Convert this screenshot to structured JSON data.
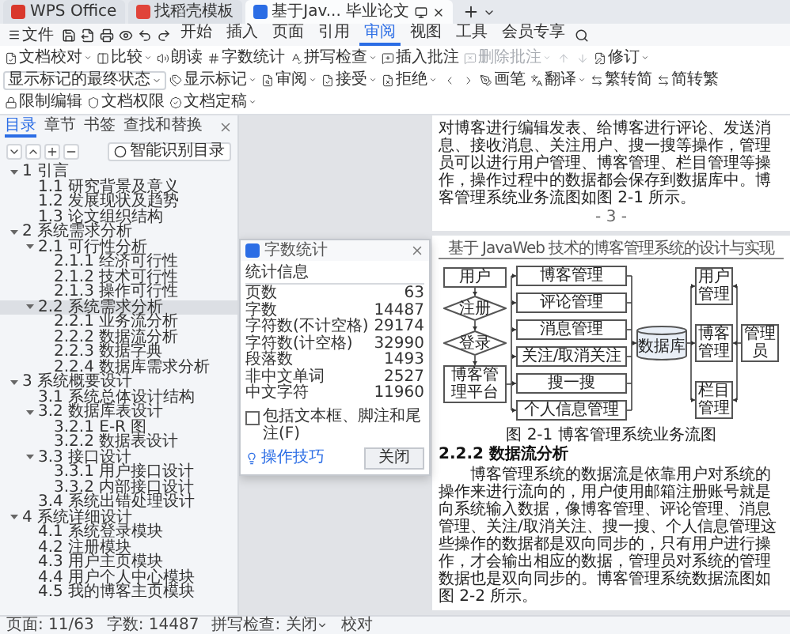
{
  "tabs": [
    {
      "label": "WPS Office",
      "kind": "home",
      "selected": false
    },
    {
      "label": "找稻壳模板",
      "kind": "template",
      "selected": false
    },
    {
      "label": "基于Jav... 毕业论文",
      "kind": "document",
      "selected": true
    }
  ],
  "menu": {
    "file": "文件",
    "tabs": [
      {
        "label": "开始",
        "selected": false
      },
      {
        "label": "插入",
        "selected": false
      },
      {
        "label": "页面",
        "selected": false
      },
      {
        "label": "引用",
        "selected": false
      },
      {
        "label": "审阅",
        "selected": true
      },
      {
        "label": "视图",
        "selected": false
      },
      {
        "label": "工具",
        "selected": false
      },
      {
        "label": "会员专享",
        "selected": false
      }
    ]
  },
  "ribbon": [
    {
      "kind": "button",
      "label": "文档校对",
      "caret": true,
      "disabled": false
    },
    {
      "kind": "button",
      "label": "比较",
      "caret": true,
      "disabled": false
    },
    {
      "kind": "button",
      "label": "朗读",
      "caret": false,
      "disabled": false
    },
    {
      "kind": "button",
      "label": "字数统计",
      "caret": false,
      "disabled": false
    },
    {
      "kind": "button",
      "label": "拼写检查",
      "caret": true,
      "disabled": false
    },
    {
      "kind": "button",
      "label": "插入批注",
      "caret": false,
      "disabled": false
    },
    {
      "kind": "button",
      "label": "删除批注",
      "caret": true,
      "disabled": true
    },
    {
      "kind": "icon",
      "disabled": true
    },
    {
      "kind": "icon",
      "disabled": true
    },
    {
      "kind": "button",
      "label": "修订",
      "caret": true,
      "disabled": false
    },
    {
      "kind": "dropdown",
      "value": "显示标记的最终状态"
    },
    {
      "kind": "button",
      "label": "显示标记",
      "caret": true,
      "disabled": false
    },
    {
      "kind": "button",
      "label": "审阅",
      "caret": true,
      "disabled": false
    },
    {
      "kind": "button",
      "label": "接受",
      "caret": true,
      "disabled": false
    },
    {
      "kind": "button",
      "label": "拒绝",
      "caret": true,
      "disabled": false
    },
    {
      "kind": "icon",
      "disabled": false
    },
    {
      "kind": "icon",
      "disabled": false
    },
    {
      "kind": "button",
      "label": "画笔",
      "caret": false,
      "disabled": false
    },
    {
      "kind": "button",
      "label": "翻译",
      "caret": true,
      "disabled": false
    },
    {
      "kind": "button",
      "label": "繁转简",
      "caret": false,
      "disabled": false
    },
    {
      "kind": "button",
      "label": "简转繁",
      "caret": false,
      "disabled": false
    },
    {
      "kind": "button",
      "label": "限制编辑",
      "caret": false,
      "disabled": false
    },
    {
      "kind": "button",
      "label": "文档权限",
      "caret": false,
      "disabled": false
    },
    {
      "kind": "button",
      "label": "文档定稿",
      "caret": true,
      "disabled": false
    }
  ],
  "sidebar": {
    "tabs": [
      {
        "label": "目录",
        "selected": true
      },
      {
        "label": "章节",
        "selected": false
      },
      {
        "label": "书签",
        "selected": false
      },
      {
        "label": "查找和替换",
        "selected": false
      }
    ],
    "smart_button": "智能识别目录",
    "outline": [
      {
        "label": "1 引言",
        "expanded": true,
        "selected": false,
        "children": [
          {
            "label": "1.1 研究背景及意义",
            "selected": false
          },
          {
            "label": "1.2 发展现状及趋势",
            "selected": false
          },
          {
            "label": "1.3 论文组织结构",
            "selected": false
          }
        ]
      },
      {
        "label": "2 系统需求分析",
        "expanded": true,
        "selected": false,
        "children": [
          {
            "label": "2.1 可行性分析",
            "expanded": true,
            "selected": false,
            "children": [
              {
                "label": "2.1.1 经济可行性",
                "selected": false
              },
              {
                "label": "2.1.2 技术可行性",
                "selected": false
              },
              {
                "label": "2.1.3 操作可行性",
                "selected": false
              }
            ]
          },
          {
            "label": "2.2 系统需求分析",
            "expanded": true,
            "selected": true,
            "children": [
              {
                "label": "2.2.1 业务流分析",
                "selected": false
              },
              {
                "label": "2.2.2 数据流分析",
                "selected": false
              },
              {
                "label": "2.2.3 数据字典",
                "selected": false
              },
              {
                "label": "2.2.4 数据库需求分析",
                "selected": false
              }
            ]
          }
        ]
      },
      {
        "label": "3 系统概要设计",
        "expanded": true,
        "selected": false,
        "children": [
          {
            "label": "3.1 系统总体设计结构",
            "selected": false
          },
          {
            "label": "3.2 数据库表设计",
            "expanded": true,
            "selected": false,
            "children": [
              {
                "label": "3.2.1 E-R 图",
                "selected": false
              },
              {
                "label": "3.2.2 数据表设计",
                "selected": false
              }
            ]
          },
          {
            "label": "3.3 接口设计",
            "expanded": true,
            "selected": false,
            "children": [
              {
                "label": "3.3.1 用户接口设计",
                "selected": false
              },
              {
                "label": "3.3.2 内部接口设计",
                "selected": false
              }
            ]
          },
          {
            "label": "3.4 系统出错处理设计",
            "selected": false
          }
        ]
      },
      {
        "label": "4 系统详细设计",
        "expanded": true,
        "selected": false,
        "children": [
          {
            "label": "4.1 系统登录模块",
            "selected": false
          },
          {
            "label": "4.2 注册模块",
            "selected": false
          },
          {
            "label": "4.3 用户主页模块",
            "selected": false
          },
          {
            "label": "4.4 用户个人中心模块",
            "selected": false
          },
          {
            "label": "4.5 我的博客主页模块",
            "selected": false
          }
        ]
      }
    ]
  },
  "dialog": {
    "title": "字数统计",
    "section": "统计信息",
    "stats": [
      {
        "label": "页数",
        "value": "63"
      },
      {
        "label": "字数",
        "value": "14487"
      },
      {
        "label": "字符数(不计空格)",
        "value": "29174"
      },
      {
        "label": "字符数(计空格)",
        "value": "32990"
      },
      {
        "label": "段落数",
        "value": "1493"
      },
      {
        "label": "非中文单词",
        "value": "2527"
      },
      {
        "label": "中文字符",
        "value": "11960"
      }
    ],
    "checkbox": {
      "label": "包括文本框、脚注和尾注(F)",
      "checked": false
    },
    "tips_link": "操作技巧",
    "close_button": "关闭"
  },
  "document": {
    "page1": {
      "paragraph": "对博客进行编辑发表、给博客进行评论、发送消息、接收消息、关注用户、搜一搜等操作，管理员可以进行用户管理、博客管理、栏目管理等操作，操作过程中的数据都会保存到数据库中。博客管理系统业务流图如图 2-1 所示。",
      "page_number": "- 3 -"
    },
    "page2": {
      "header": "基于 JavaWeb 技术的博客管理系统的设计与实现",
      "diagram": [
        {
          "kind": "process",
          "label": "用户"
        },
        {
          "kind": "decision",
          "label": "注册"
        },
        {
          "kind": "decision",
          "label": "登录"
        },
        {
          "kind": "process",
          "label": "博客管理平台"
        },
        {
          "kind": "process",
          "label": "博客管理"
        },
        {
          "kind": "process",
          "label": "评论管理"
        },
        {
          "kind": "process",
          "label": "消息管理"
        },
        {
          "kind": "process",
          "label": "关注/取消关注"
        },
        {
          "kind": "process",
          "label": "搜一搜"
        },
        {
          "kind": "process",
          "label": "个人信息管理"
        },
        {
          "kind": "database",
          "label": "数据库"
        },
        {
          "kind": "process",
          "label": "用户管理"
        },
        {
          "kind": "process",
          "label": "博客管理"
        },
        {
          "kind": "process",
          "label": "栏目管理"
        },
        {
          "kind": "process",
          "label": "管理员"
        }
      ],
      "caption": "图 2-1 博客管理系统业务流图",
      "heading": "2.2.2 数据流分析",
      "paragraph": "博客管理系统的数据流是依靠用户对系统的操作来进行流向的，用户使用邮箱注册账号就是向系统输入数据，像博客管理、评论管理、消息管理、关注/取消关注、搜一搜、个人信息管理这些操作的数据都是双向同步的，只有用户进行操作，才会输出相应的数据，管理员对系统的管理数据也是双向同步的。博客管理系统数据流图如图 2-2 所示。"
    }
  },
  "status_bar": {
    "page": "页面: 11/63",
    "words": "字数: 14487",
    "spell": "拼写检查: 关闭",
    "proofread": "校对"
  }
}
